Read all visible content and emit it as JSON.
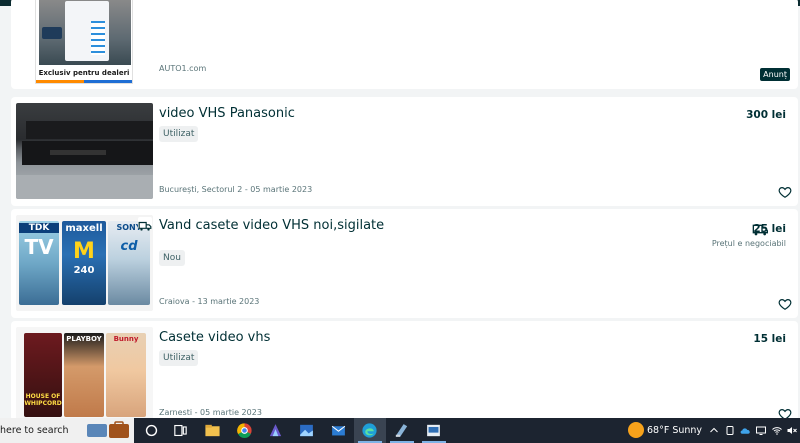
{
  "listings": [
    {
      "ad_banner_text": "Exclusiv pentru dealeri",
      "source": "AUTO1.com",
      "badge": "Anunț"
    },
    {
      "title": "video VHS Panasonic",
      "condition": "Utilizat",
      "location_date": "București, Sectorul 2 - 05 martie 2023",
      "price": "300 lei"
    },
    {
      "title": "Vand casete video VHS noi,sigilate",
      "condition": "Nou",
      "location_date": "Craiova - 13 martie 2023",
      "price": "25 lei",
      "negotiable": "Prețul e negociabil",
      "tape_labels": [
        "TDK",
        "maxell",
        "SONY"
      ],
      "tape_big": [
        "TV",
        "M",
        "cd"
      ],
      "tape_num": "240"
    },
    {
      "title": "Casete video vhs",
      "condition": "Utilizat",
      "location_date": "Zarnesti - 05 martie 2023",
      "price": "15 lei",
      "tape_labels": [
        "HOUSE OF WHIPCORD",
        "PLAYBOY",
        "Bunny"
      ]
    }
  ],
  "taskbar": {
    "search_text": "here to search",
    "weather": "68°F  Sunny"
  },
  "colors": {
    "accent": "#002f34",
    "page_bg": "#f2f4f5",
    "taskbar_bg": "#1c2430"
  }
}
